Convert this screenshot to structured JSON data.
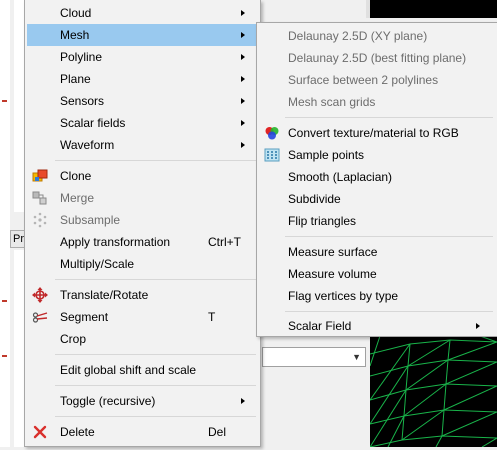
{
  "main_menu": {
    "items": [
      {
        "label": "Cloud",
        "submenu": true
      },
      {
        "label": "Mesh",
        "submenu": true,
        "highlighted": true
      },
      {
        "label": "Polyline",
        "submenu": true
      },
      {
        "label": "Plane",
        "submenu": true
      },
      {
        "label": "Sensors",
        "submenu": true
      },
      {
        "label": "Scalar fields",
        "submenu": true
      },
      {
        "label": "Waveform",
        "submenu": true
      },
      {
        "label": "Clone",
        "icon": "clone-icon"
      },
      {
        "label": "Merge",
        "icon": "merge-icon",
        "disabled": true
      },
      {
        "label": "Subsample",
        "icon": "subsample-icon",
        "disabled": true
      },
      {
        "label": "Apply transformation",
        "shortcut": "Ctrl+T"
      },
      {
        "label": "Multiply/Scale"
      },
      {
        "label": "Translate/Rotate",
        "icon": "translate-rotate-icon"
      },
      {
        "label": "Segment",
        "icon": "scissors-icon",
        "shortcut": "T"
      },
      {
        "label": "Crop"
      },
      {
        "label": "Edit global shift and scale"
      },
      {
        "label": "Toggle (recursive)",
        "submenu": true
      },
      {
        "label": "Delete",
        "icon": "delete-icon",
        "shortcut": "Del"
      }
    ]
  },
  "mesh_submenu": {
    "items": [
      {
        "label": "Delaunay 2.5D (XY plane)",
        "disabled": true
      },
      {
        "label": "Delaunay 2.5D (best fitting plane)",
        "disabled": true
      },
      {
        "label": "Surface between 2 polylines",
        "disabled": true
      },
      {
        "label": "Mesh scan grids",
        "disabled": true
      },
      {
        "label": "Convert texture/material to RGB",
        "icon": "rgb-circles-icon"
      },
      {
        "label": "Sample points",
        "icon": "sample-points-icon"
      },
      {
        "label": "Smooth (Laplacian)"
      },
      {
        "label": "Subdivide"
      },
      {
        "label": "Flip triangles"
      },
      {
        "label": "Measure surface"
      },
      {
        "label": "Measure volume"
      },
      {
        "label": "Flag vertices by type"
      },
      {
        "label": "Scalar Field",
        "submenu": true
      }
    ]
  },
  "background": {
    "tab_label": "Pr"
  },
  "colors": {
    "highlight": "#99c9ef",
    "mesh_lines": "#19b44a",
    "delete_x": "#d9302c"
  }
}
